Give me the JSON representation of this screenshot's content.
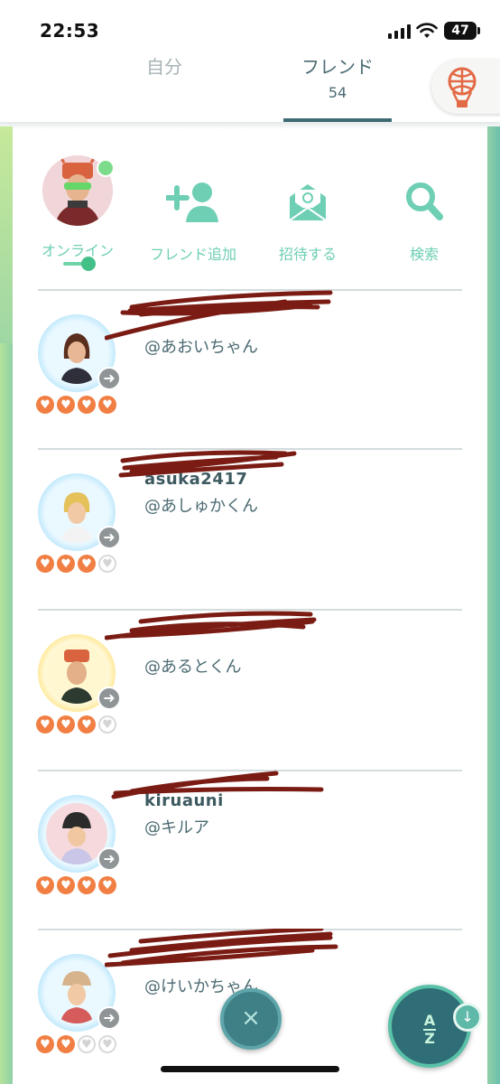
{
  "status_bar": {
    "time": "22:53",
    "battery": "47"
  },
  "tabs": [
    {
      "label": "自分",
      "count": ""
    },
    {
      "label": "フレンド",
      "count": "54"
    }
  ],
  "actions": {
    "online": "オンライン",
    "add_friend": "フレンド追加",
    "invite": "招待する",
    "search": "検索"
  },
  "friends": [
    {
      "name": "",
      "nickname": "@あおいちゃん",
      "hearts": [
        1,
        1,
        1,
        1
      ]
    },
    {
      "name": "asuka2417",
      "nickname": "@あしゅかくん",
      "hearts": [
        1,
        1,
        1,
        0
      ]
    },
    {
      "name": "",
      "nickname": "@あるとくん",
      "hearts": [
        1,
        1,
        1,
        0
      ]
    },
    {
      "name": "kiruauni",
      "nickname": "@キルア",
      "hearts": [
        1,
        1,
        1,
        1
      ]
    },
    {
      "name": "",
      "nickname": "@けいかちゃん",
      "hearts": [
        1,
        1,
        0,
        0
      ]
    }
  ],
  "fabs": {
    "close": "×",
    "sort_top": "A",
    "sort_bottom": "Z",
    "sort_badge": "↓"
  },
  "icons": [
    "signal-icon",
    "wifi-icon",
    "battery-icon",
    "balloon-icon",
    "add-friend-icon",
    "invite-mail-icon",
    "search-icon",
    "arrow-right-icon",
    "heart-icon",
    "close-icon",
    "sort-az-icon"
  ],
  "colors": {
    "accent": "#6ecfb5",
    "tab_active": "#3d6b73",
    "heart": "#f17f43",
    "fab": "#2f6e76",
    "scribble": "#7a1c14"
  }
}
